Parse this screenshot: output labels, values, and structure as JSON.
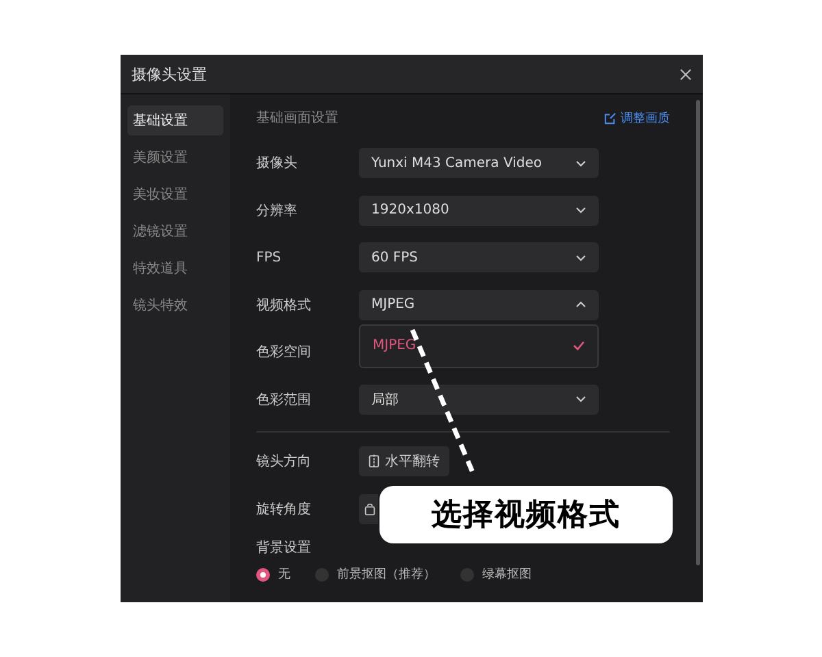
{
  "window": {
    "title": "摄像头设置"
  },
  "sidebar": {
    "items": [
      {
        "label": "基础设置",
        "selected": true
      },
      {
        "label": "美颜设置",
        "selected": false
      },
      {
        "label": "美妆设置",
        "selected": false
      },
      {
        "label": "滤镜设置",
        "selected": false
      },
      {
        "label": "特效道具",
        "selected": false
      },
      {
        "label": "镜头特效",
        "selected": false
      }
    ]
  },
  "section": {
    "title": "基础画面设置",
    "link": "调整画质"
  },
  "rows": [
    {
      "kind": "select",
      "label": "摄像头",
      "value": "Yunxi M43 Camera Video",
      "expanded": false
    },
    {
      "kind": "select",
      "label": "分辨率",
      "value": "1920x1080",
      "expanded": false
    },
    {
      "kind": "select",
      "label": "FPS",
      "value": "60 FPS",
      "expanded": false
    },
    {
      "kind": "select",
      "label": "视频格式",
      "value": "MJPEG",
      "expanded": true,
      "options": [
        {
          "label": "MJPEG",
          "selected": true
        }
      ]
    },
    {
      "kind": "covered",
      "label": "色彩空间"
    },
    {
      "kind": "select",
      "label": "色彩范围",
      "value": "局部",
      "expanded": false
    }
  ],
  "orientation_rows": [
    {
      "kind": "flip",
      "label": "镜头方向",
      "button": "水平翻转"
    },
    {
      "kind": "rotate",
      "label": "旋转角度"
    }
  ],
  "background": {
    "label": "背景设置",
    "options": [
      {
        "label": "无",
        "selected": true
      },
      {
        "label": "前景抠图（推荐）",
        "selected": false
      },
      {
        "label": "绿幕抠图",
        "selected": false
      }
    ]
  },
  "callout": {
    "text": "选择视频格式"
  }
}
